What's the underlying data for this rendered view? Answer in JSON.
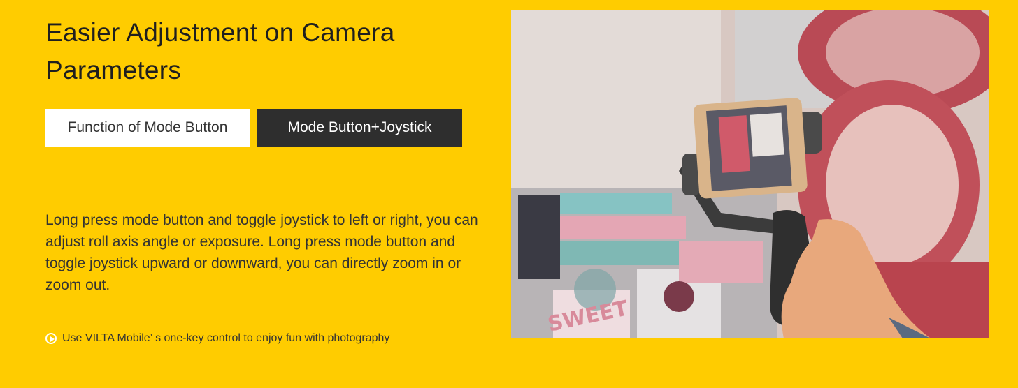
{
  "heading": {
    "title": "Easier Adjustment on Camera Parameters"
  },
  "tabs": [
    {
      "label": "Function of Mode Button",
      "active": false
    },
    {
      "label": "Mode Button+Joystick",
      "active": true
    }
  ],
  "description": "Long press mode button and toggle joystick to left or right, you can adjust roll axis angle or exposure. Long press mode button and toggle joystick upward or downward, you can directly zoom in or zoom out.",
  "footer_link": {
    "icon": "play-circle-icon",
    "text": "Use VILTA Mobile’ s one-key control to enjoy fun with photography"
  },
  "photo": {
    "text": "SWEET"
  },
  "colors": {
    "background": "#FFCC00",
    "active_tab": "#2E2E2E",
    "inactive_tab": "#FFFFFF"
  }
}
